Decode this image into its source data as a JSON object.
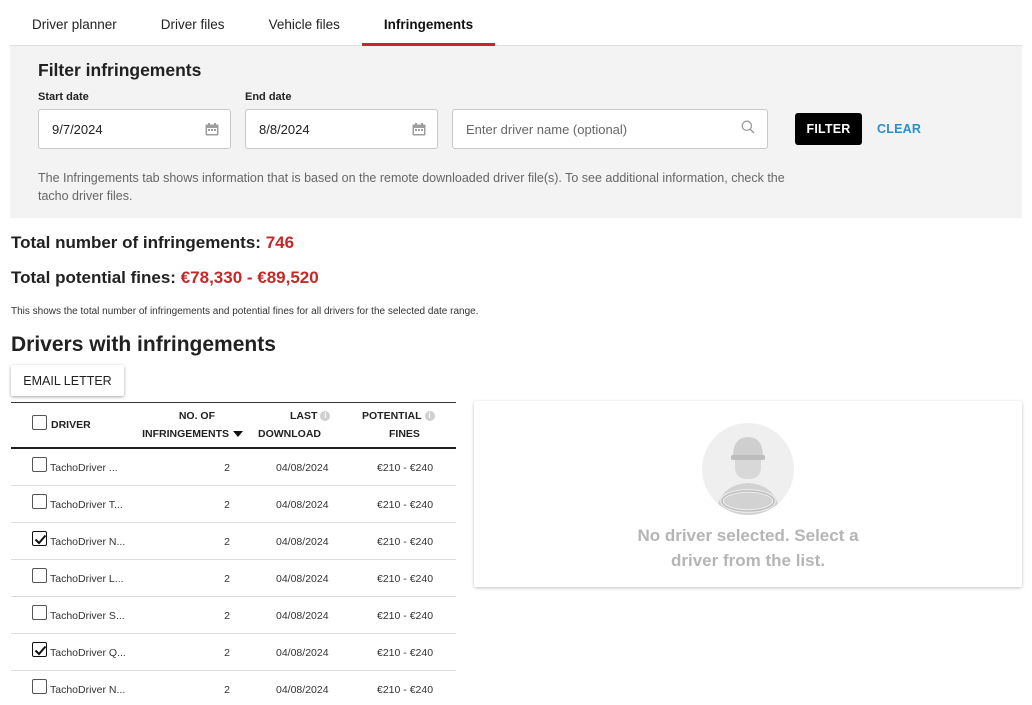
{
  "tabs": [
    {
      "label": "Driver planner",
      "active": false
    },
    {
      "label": "Driver files",
      "active": false
    },
    {
      "label": "Vehicle files",
      "active": false
    },
    {
      "label": "Infringements",
      "active": true
    }
  ],
  "filter": {
    "title": "Filter infringements",
    "start_label": "Start date",
    "start_value": "9/7/2024",
    "end_label": "End date",
    "end_value": "8/8/2024",
    "driver_placeholder": "Enter driver name (optional)",
    "driver_value": "",
    "filter_button": "FILTER",
    "clear_button": "CLEAR",
    "info": "The Infringements tab shows information that is based on the remote downloaded driver file(s). To see additional information, check the tacho driver files."
  },
  "totals": {
    "infringements_label": "Total number of infringements:",
    "infringements_value": "746",
    "fines_label": "Total potential fines:",
    "fines_value": "€78,330 - €89,520",
    "note": "This shows the total number of infringements and potential fines for all drivers for the selected date range."
  },
  "drivers": {
    "heading": "Drivers with infringements",
    "email_button": "EMAIL LETTER",
    "columns": {
      "driver": "DRIVER",
      "infringements_1": "NO. OF",
      "infringements_2": "INFRINGEMENTS",
      "last_1": "LAST",
      "last_2": "DOWNLOAD",
      "fines_1": "POTENTIAL",
      "fines_2": "FINES"
    },
    "rows": [
      {
        "name": "TachoDriver ...",
        "count": "2",
        "last": "04/08/2024",
        "fines": "€210 - €240",
        "checked": false
      },
      {
        "name": "TachoDriver T...",
        "count": "2",
        "last": "04/08/2024",
        "fines": "€210 - €240",
        "checked": false
      },
      {
        "name": "TachoDriver N...",
        "count": "2",
        "last": "04/08/2024",
        "fines": "€210 - €240",
        "checked": true
      },
      {
        "name": "TachoDriver L...",
        "count": "2",
        "last": "04/08/2024",
        "fines": "€210 - €240",
        "checked": false
      },
      {
        "name": "TachoDriver S...",
        "count": "2",
        "last": "04/08/2024",
        "fines": "€210 - €240",
        "checked": false
      },
      {
        "name": "TachoDriver Q...",
        "count": "2",
        "last": "04/08/2024",
        "fines": "€210 - €240",
        "checked": true
      },
      {
        "name": "TachoDriver N...",
        "count": "2",
        "last": "04/08/2024",
        "fines": "€210 - €240",
        "checked": false
      }
    ]
  },
  "empty_state": {
    "icon": "driver-avatar-icon",
    "message_1": "No driver selected. Select a",
    "message_2": "driver from the list."
  },
  "colors": {
    "accent_red": "#c62828",
    "link_blue": "#2a8fc9",
    "panel_bg": "#f3f3f3"
  }
}
